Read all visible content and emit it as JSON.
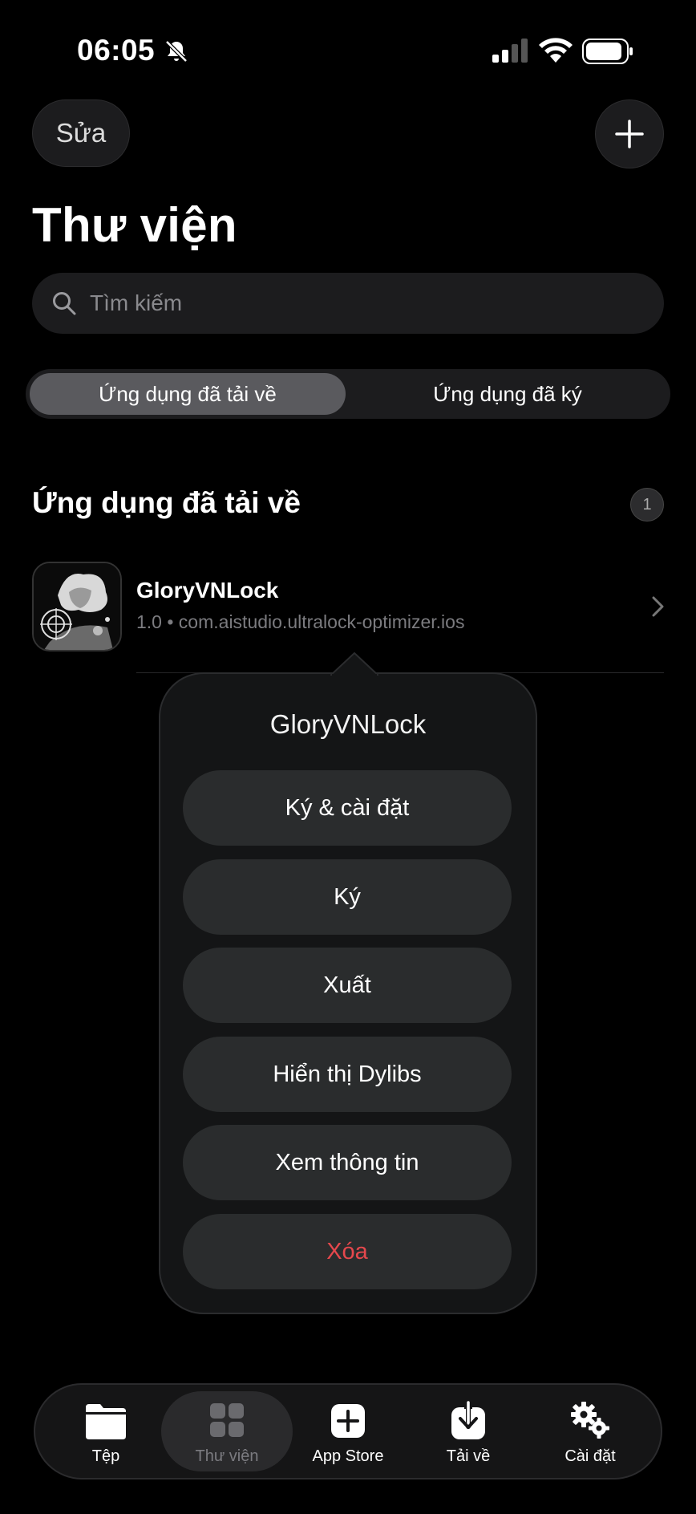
{
  "status_bar": {
    "time": "06:05"
  },
  "header": {
    "edit_label": "Sửa",
    "title": "Thư viện"
  },
  "search": {
    "placeholder": "Tìm kiếm"
  },
  "segments": {
    "downloaded": "Ứng dụng đã tải về",
    "signed": "Ứng dụng đã ký"
  },
  "section": {
    "title": "Ứng dụng đã tải về",
    "count": "1"
  },
  "app": {
    "name": "GloryVNLock",
    "subtitle": "1.0 • com.aistudio.ultralock-optimizer.ios"
  },
  "popover": {
    "title": "GloryVNLock",
    "actions": [
      "Ký & cài đặt",
      "Ký",
      "Xuất",
      "Hiển thị Dylibs",
      "Xem thông tin",
      "Xóa"
    ]
  },
  "tabbar": {
    "files": "Tệp",
    "library": "Thư viện",
    "app_store": "App Store",
    "downloads": "Tải về",
    "settings": "Cài đặt"
  },
  "colors": {
    "background": "#000000",
    "danger": "#e5484d",
    "active_segment": "#5a5a5e"
  },
  "icons": [
    "bell-slash-icon",
    "cellular-signal-icon",
    "wifi-icon",
    "battery-icon",
    "plus-icon",
    "search-icon",
    "chevron-right-icon",
    "folder-icon",
    "grid-icon",
    "plus-square-icon",
    "download-icon",
    "gears-icon"
  ]
}
